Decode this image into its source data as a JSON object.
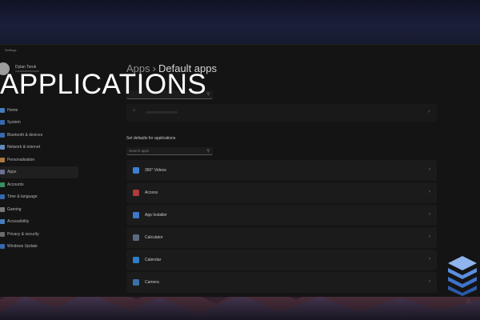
{
  "window": {
    "title": "Settings"
  },
  "user": {
    "name": "Dylan Torok"
  },
  "overlay_title": "APPLICATIONS",
  "sidebar": {
    "items": [
      {
        "label": "Home",
        "icon": "home-icon",
        "color": "#4f8fdc"
      },
      {
        "label": "System",
        "icon": "monitor-icon",
        "color": "#3c78c8"
      },
      {
        "label": "Bluetooth & devices",
        "icon": "bluetooth-icon",
        "color": "#3c78c8"
      },
      {
        "label": "Network & internet",
        "icon": "wifi-icon",
        "color": "#6fa0d8"
      },
      {
        "label": "Personalisation",
        "icon": "brush-icon",
        "color": "#c88a4a"
      },
      {
        "label": "Apps",
        "icon": "apps-icon",
        "color": "#7a7fa8",
        "active": true
      },
      {
        "label": "Accounts",
        "icon": "person-icon",
        "color": "#3fa36a"
      },
      {
        "label": "Time & language",
        "icon": "globe-icon",
        "color": "#3c78c8"
      },
      {
        "label": "Gaming",
        "icon": "controller-icon",
        "color": "#8a8a8a"
      },
      {
        "label": "Accessibility",
        "icon": "accessibility-icon",
        "color": "#4f8fdc"
      },
      {
        "label": "Privacy & security",
        "icon": "shield-icon",
        "color": "#7a7a7a"
      },
      {
        "label": "Windows Update",
        "icon": "update-icon",
        "color": "#3c78c8"
      }
    ]
  },
  "breadcrumb": {
    "parent": "Apps",
    "separator": "›",
    "current": "Default apps"
  },
  "header_hint": "type",
  "section": {
    "label": "Set defaults for applications"
  },
  "apps_search": {
    "placeholder": "Search apps"
  },
  "apps": [
    {
      "name": "360° Videos",
      "color": "#3c7fd0"
    },
    {
      "name": "Access",
      "color": "#b03a3a"
    },
    {
      "name": "App Installer",
      "color": "#3c78c8"
    },
    {
      "name": "Calculator",
      "color": "#5a6a80"
    },
    {
      "name": "Calendar",
      "color": "#2f7fc8"
    },
    {
      "name": "Camera",
      "color": "#3a6fa8"
    }
  ]
}
